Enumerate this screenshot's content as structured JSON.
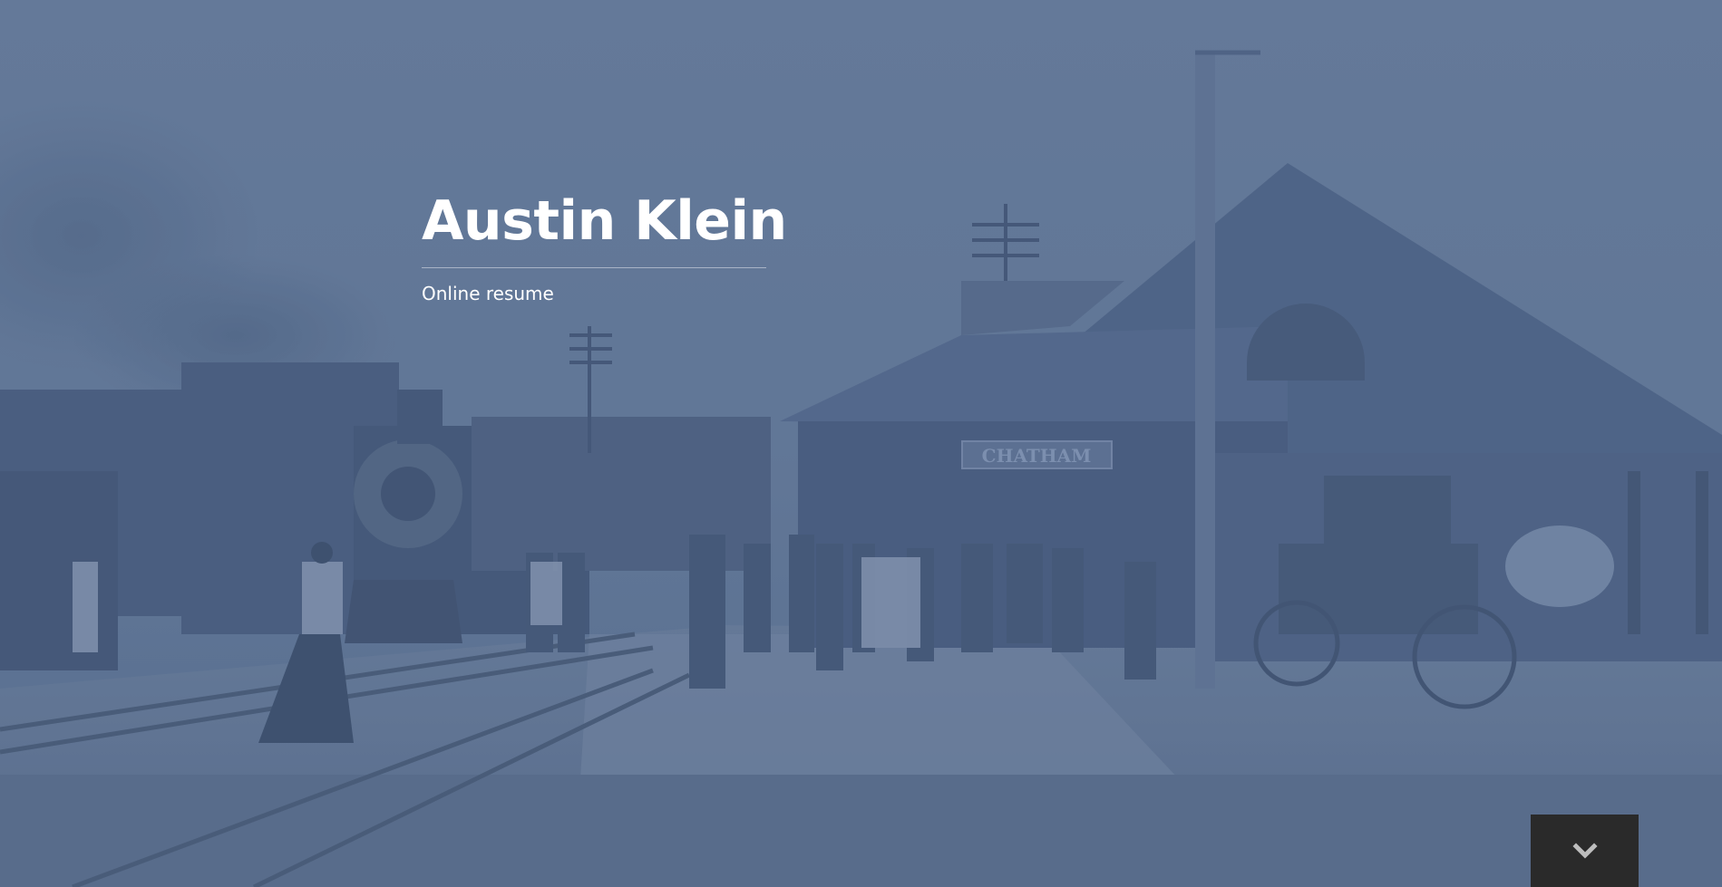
{
  "hero": {
    "name": "Austin Klein",
    "tagline": "Online resume",
    "station_sign": "CHATHAM",
    "scroll_button": {
      "icon": "chevron-down-icon"
    }
  },
  "colors": {
    "tint": "#5d7391",
    "title_text": "#ffffff",
    "scroll_button_bg": "#2a2a2a",
    "scroll_icon": "#bdbdbd"
  }
}
